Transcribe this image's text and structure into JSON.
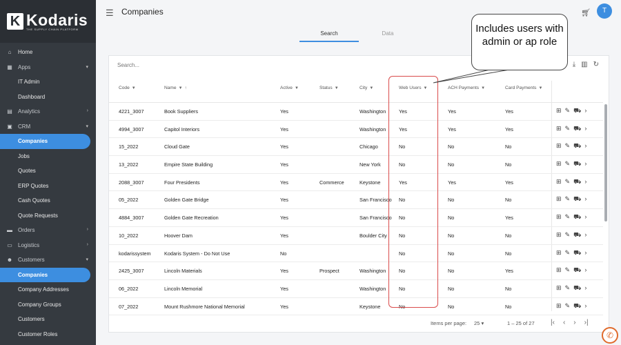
{
  "app": {
    "logo_name": "Kodaris",
    "logo_tagline": "THE SUPPLY CHAIN PLATFORM",
    "page_title": "Companies",
    "avatar_letter": "T",
    "accent": "#3d8ee0"
  },
  "tabs": [
    {
      "label": "Search"
    },
    {
      "label": "Data"
    }
  ],
  "sidebar": {
    "items": [
      {
        "label": "Home",
        "icon": "home-icon"
      },
      {
        "label": "Apps",
        "icon": "apps-icon"
      },
      {
        "label": "IT Admin"
      },
      {
        "label": "Dashboard"
      },
      {
        "label": "Analytics",
        "icon": "analytics-icon"
      },
      {
        "label": "CRM",
        "icon": "crm-icon"
      },
      {
        "label": "Companies"
      },
      {
        "label": "Jobs"
      },
      {
        "label": "Quotes"
      },
      {
        "label": "ERP Quotes"
      },
      {
        "label": "Cash Quotes"
      },
      {
        "label": "Quote Requests"
      },
      {
        "label": "Orders",
        "icon": "orders-icon"
      },
      {
        "label": "Logistics",
        "icon": "logistics-icon"
      },
      {
        "label": "Customers",
        "icon": "customers-icon"
      },
      {
        "label": "Companies"
      },
      {
        "label": "Company Addresses"
      },
      {
        "label": "Company Groups"
      },
      {
        "label": "Customers"
      },
      {
        "label": "Customer Roles"
      }
    ]
  },
  "table": {
    "search_placeholder": "Search...",
    "columns": [
      "Code",
      "Name",
      "Active",
      "Status",
      "City",
      "Web Users",
      "ACH Payments",
      "Card Payments"
    ],
    "rows": [
      [
        "4221_3007",
        "Book Suppliers",
        "Yes",
        "",
        "Washington",
        "Yes",
        "Yes",
        "Yes"
      ],
      [
        "4994_3007",
        "Capitol Interiors",
        "Yes",
        "",
        "Washington",
        "Yes",
        "Yes",
        "Yes"
      ],
      [
        "15_2022",
        "Cloud Gate",
        "Yes",
        "",
        "Chicago",
        "No",
        "No",
        "No"
      ],
      [
        "13_2022",
        "Empire State Building",
        "Yes",
        "",
        "New York",
        "No",
        "No",
        "No"
      ],
      [
        "2088_3007",
        "Four Presidents",
        "Yes",
        "Commerce",
        "Keystone",
        "Yes",
        "Yes",
        "Yes"
      ],
      [
        "05_2022",
        "Golden Gate Bridge",
        "Yes",
        "",
        "San Francisco",
        "No",
        "No",
        "No"
      ],
      [
        "4884_3007",
        "Golden Gate Recreation",
        "Yes",
        "",
        "San Francisco",
        "No",
        "No",
        "Yes"
      ],
      [
        "10_2022",
        "Hoover Dam",
        "Yes",
        "",
        "Boulder City",
        "No",
        "No",
        "No"
      ],
      [
        "kodarissystem",
        "Kodaris System - Do Not Use",
        "No",
        "",
        "",
        "No",
        "No",
        "No"
      ],
      [
        "2425_3007",
        "Lincoln Materials",
        "Yes",
        "Prospect",
        "Washington",
        "No",
        "No",
        "Yes"
      ],
      [
        "06_2022",
        "Lincoln Memorial",
        "Yes",
        "",
        "Washington",
        "No",
        "No",
        "No"
      ],
      [
        "07_2022",
        "Mount Rushmore National Memorial",
        "Yes",
        "",
        "Keystone",
        "No",
        "No",
        "No"
      ]
    ],
    "footer": {
      "items_per_page_label": "Items per page:",
      "items_per_page": "25",
      "range": "1 – 25 of 27"
    }
  },
  "annotation": {
    "text": "Includes users with admin or ap role",
    "color": "#d94a4a"
  }
}
